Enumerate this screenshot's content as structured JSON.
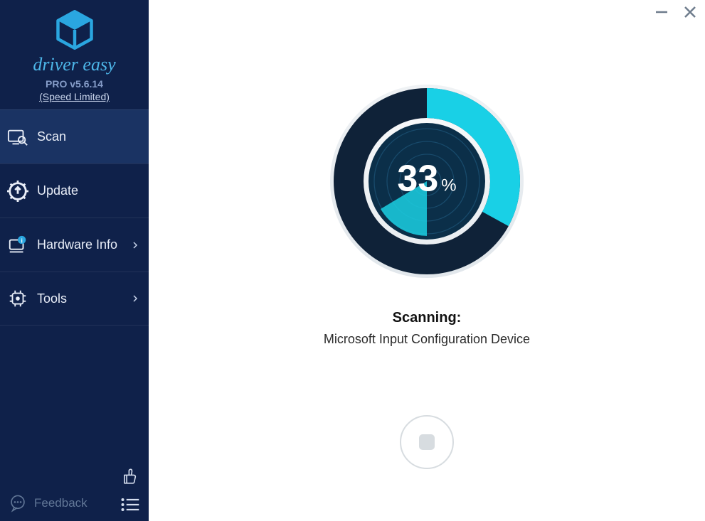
{
  "brand": {
    "name": "driver easy",
    "version": "PRO v5.6.14",
    "speed_limited": "(Speed Limited)"
  },
  "nav": {
    "items": [
      {
        "label": "Scan",
        "has_chevron": false,
        "active": true
      },
      {
        "label": "Update",
        "has_chevron": false,
        "active": false
      },
      {
        "label": "Hardware Info",
        "has_chevron": true,
        "active": false
      },
      {
        "label": "Tools",
        "has_chevron": true,
        "active": false
      }
    ]
  },
  "feedback": {
    "label": "Feedback"
  },
  "scan": {
    "percent": "33",
    "percent_symbol": "%",
    "label": "Scanning:",
    "device": "Microsoft Input Configuration Device"
  },
  "colors": {
    "accent_cyan": "#20cfe4",
    "accent_blue": "#0b88d0",
    "ring_dark": "#132a44",
    "sidebar": "#0f214a"
  }
}
